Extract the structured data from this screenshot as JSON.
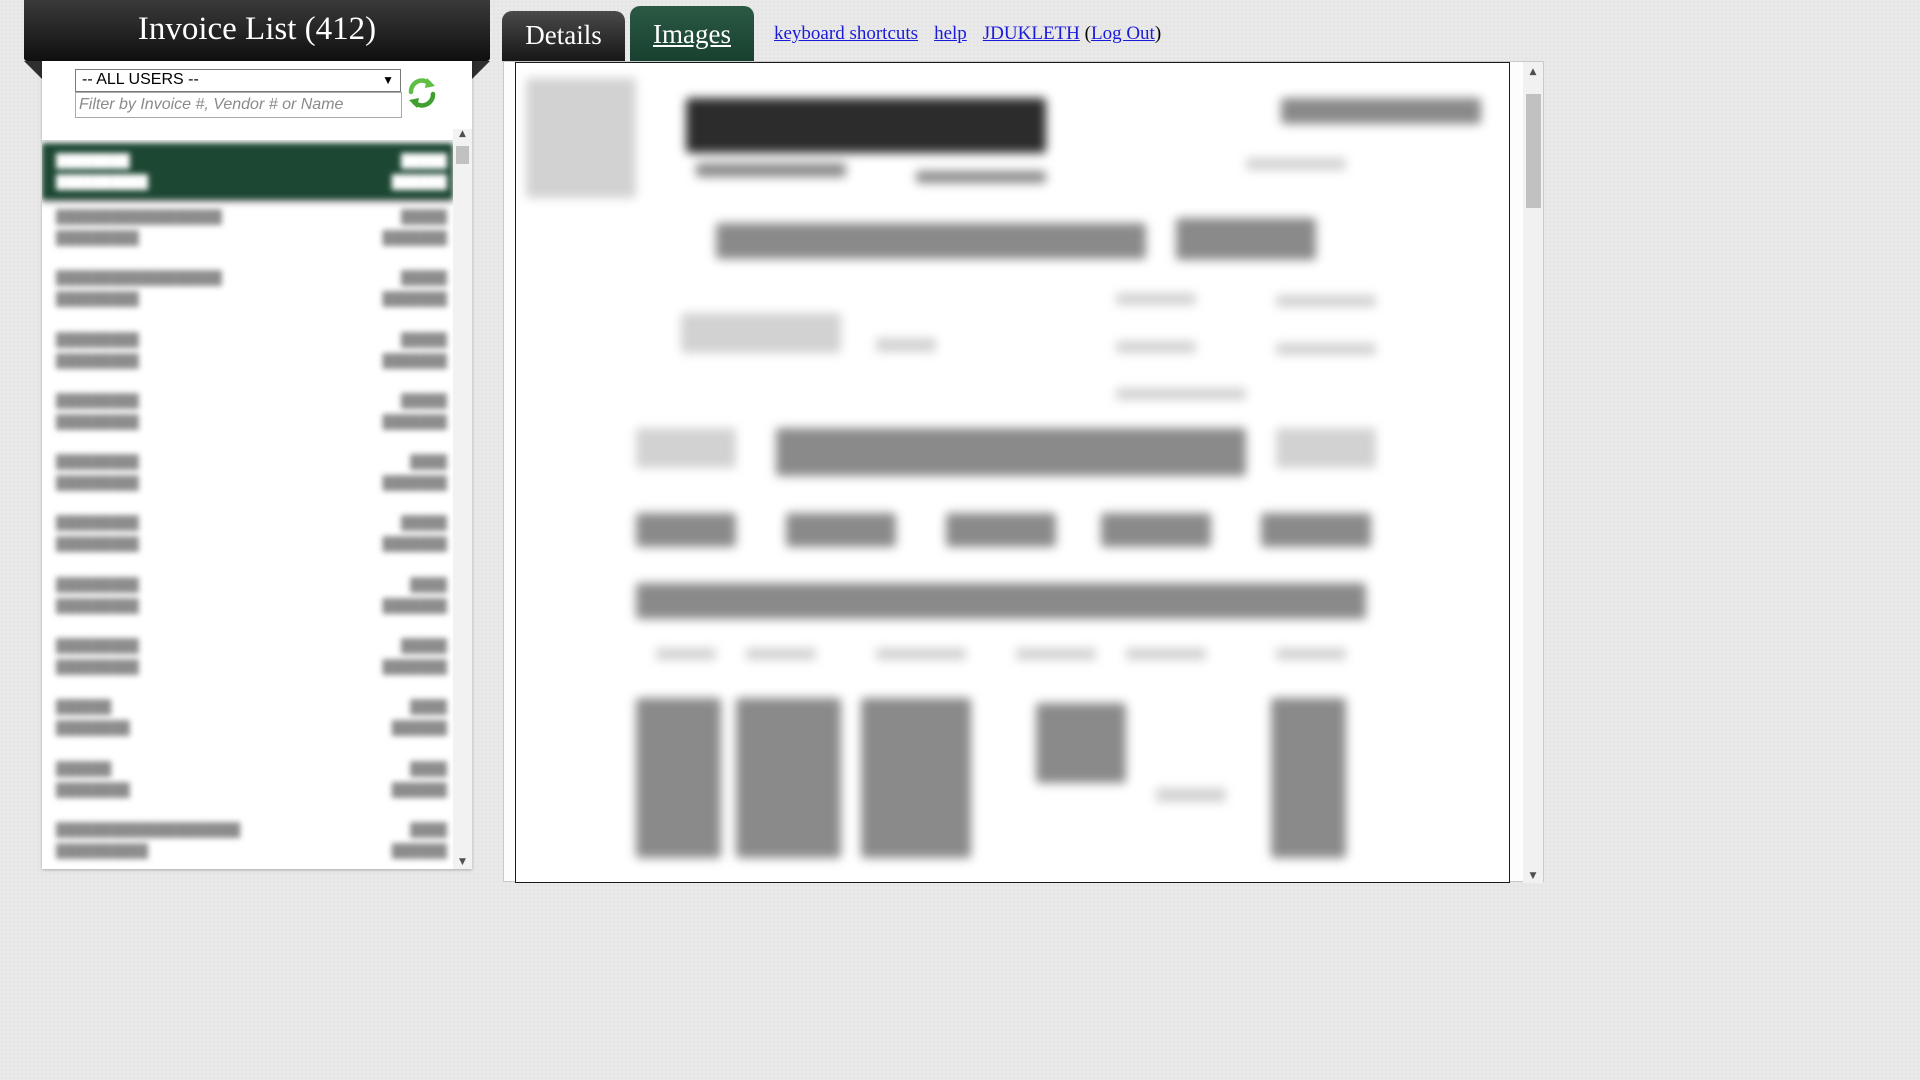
{
  "invoice_list": {
    "title": "Invoice List (412)",
    "user_filter": {
      "selected": "-- ALL USERS --"
    },
    "search": {
      "placeholder": "Filter by Invoice #, Vendor # or Name",
      "value": ""
    }
  },
  "tabs": [
    {
      "label": "Details",
      "active": false
    },
    {
      "label": "Images",
      "active": true
    }
  ],
  "links": {
    "keyboard_shortcuts": "keyboard shortcuts",
    "help": "help",
    "user": "JDUKLETH",
    "open_paren": "(",
    "logout": "Log Out",
    "close_paren": ")"
  },
  "colors": {
    "selected_row": "#1c4733",
    "active_tab": "#184030",
    "header": "#0f0f0f",
    "link": "#1a1adb"
  }
}
